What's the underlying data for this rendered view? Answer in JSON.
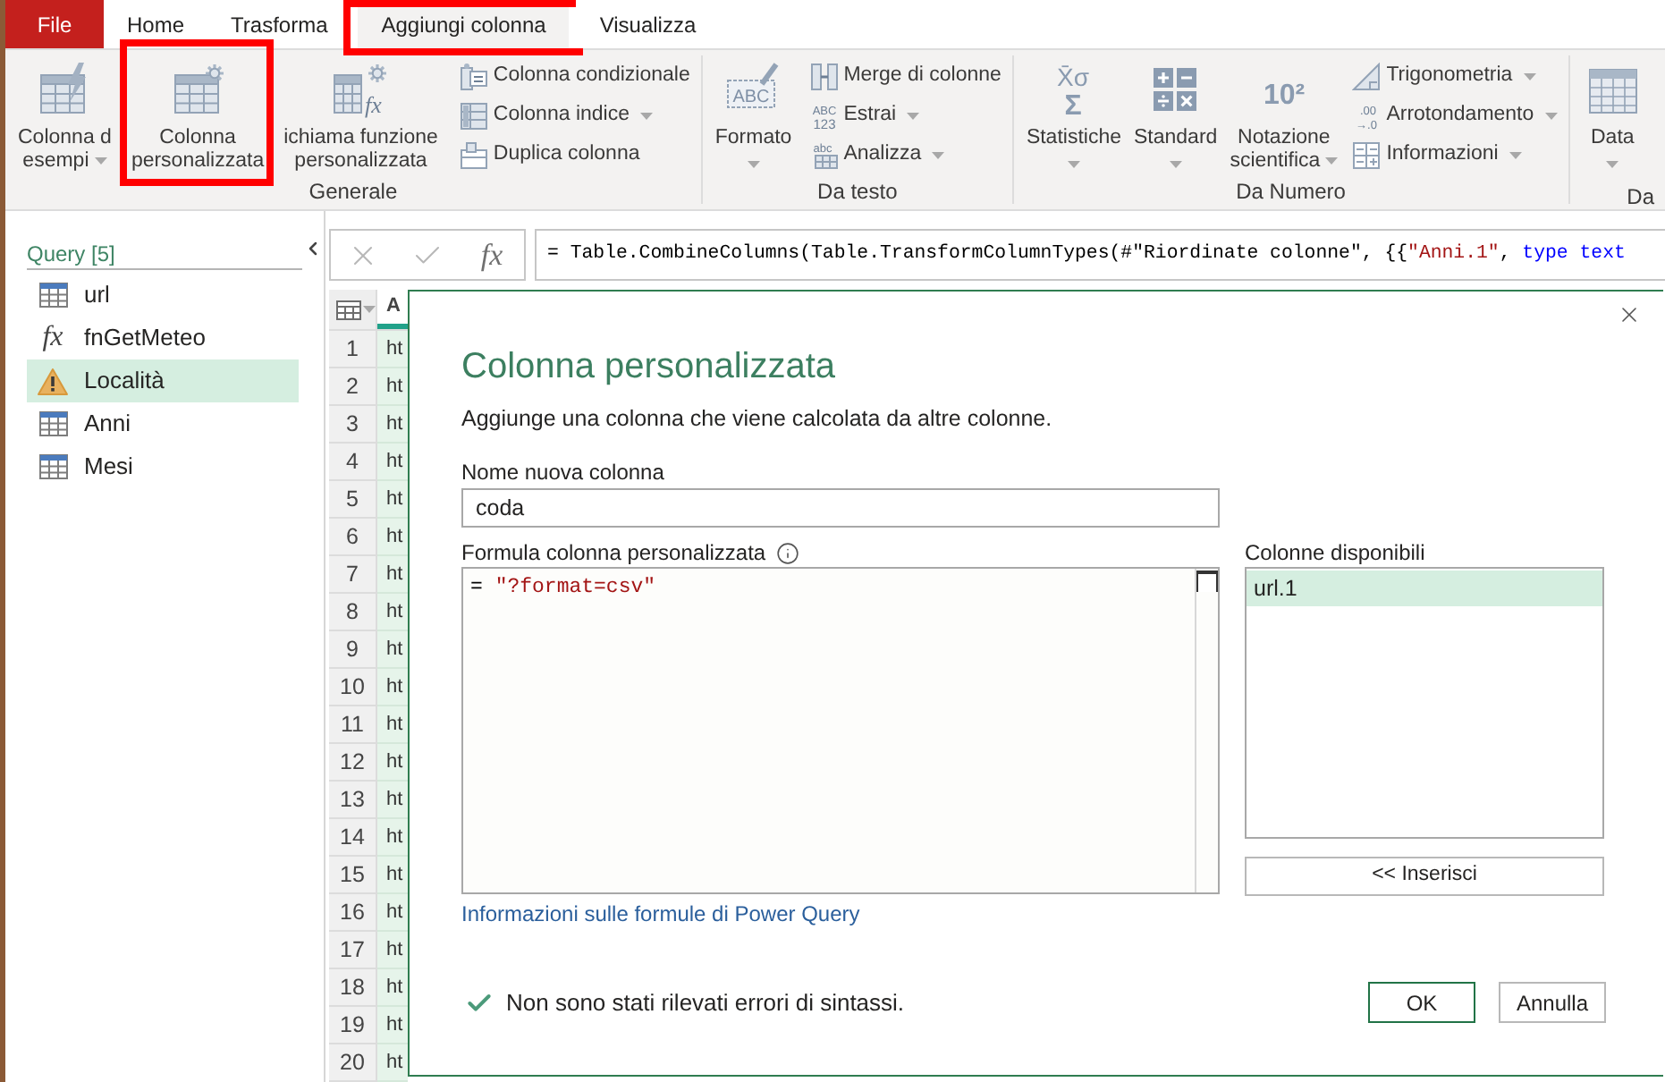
{
  "ribbon": {
    "tabs": [
      {
        "label": "File",
        "kind": "file",
        "selected": false,
        "highlighted": false
      },
      {
        "label": "Home",
        "kind": "tab",
        "selected": false,
        "highlighted": false
      },
      {
        "label": "Trasforma",
        "kind": "tab",
        "selected": false,
        "highlighted": false
      },
      {
        "label": "Aggiungi colonna",
        "kind": "tab",
        "selected": true,
        "highlighted": true
      },
      {
        "label": "Visualizza",
        "kind": "tab",
        "selected": false,
        "highlighted": false
      }
    ],
    "groups": [
      {
        "label": "Generale",
        "items": [
          {
            "kind": "large",
            "lines": [
              "Colonna d",
              "esempi"
            ],
            "dropdown": true,
            "highlighted": false
          },
          {
            "kind": "large",
            "lines": [
              "Colonna",
              "personalizzata"
            ],
            "dropdown": false,
            "highlighted": true
          },
          {
            "kind": "large",
            "lines": [
              "ichiama funzione",
              "personalizzata"
            ],
            "icon_text": "fx",
            "dropdown": false,
            "highlighted": false
          },
          {
            "kind": "small",
            "label": "Colonna condizionale",
            "dropdown": false,
            "highlighted": false
          },
          {
            "kind": "small",
            "label": "Colonna indice",
            "dropdown": true,
            "highlighted": false
          },
          {
            "kind": "small",
            "label": "Duplica colonna",
            "dropdown": false,
            "highlighted": false
          }
        ]
      },
      {
        "label": "Da testo",
        "items": [
          {
            "kind": "large",
            "lines": [
              "Formato"
            ],
            "icon_text": "ABC",
            "dropdown": true,
            "highlighted": false
          },
          {
            "kind": "small",
            "label": "Merge di colonne",
            "dropdown": false,
            "highlighted": false
          },
          {
            "kind": "small",
            "label": "Estrai",
            "icon_text": "ABC 123",
            "dropdown": true,
            "highlighted": false
          },
          {
            "kind": "small",
            "label": "Analizza",
            "icon_text": "abc",
            "dropdown": true,
            "highlighted": false
          }
        ]
      },
      {
        "label": "Da Numero",
        "items": [
          {
            "kind": "large",
            "lines": [
              "Statistiche"
            ],
            "icon_text": "X̄σ Σ",
            "dropdown": true,
            "highlighted": false
          },
          {
            "kind": "large",
            "lines": [
              "Standard"
            ],
            "dropdown": true,
            "highlighted": false
          },
          {
            "kind": "large",
            "lines": [
              "Notazione",
              "scientifica"
            ],
            "icon_text": "10²",
            "dropdown": true,
            "highlighted": false
          },
          {
            "kind": "small",
            "label": "Trigonometria",
            "dropdown": true,
            "highlighted": false
          },
          {
            "kind": "small",
            "label": "Arrotondamento",
            "icon_text": ".00 →.0",
            "dropdown": true,
            "highlighted": false
          },
          {
            "kind": "small",
            "label": "Informazioni",
            "dropdown": true,
            "highlighted": false
          }
        ]
      },
      {
        "label": "Da",
        "items": [
          {
            "kind": "large",
            "lines": [
              "Data"
            ],
            "dropdown": true,
            "highlighted": false
          }
        ]
      }
    ]
  },
  "sidebar": {
    "title": "Query [5]",
    "items": [
      {
        "label": "url",
        "kind": "table",
        "selected": false
      },
      {
        "label": "fnGetMeteo",
        "kind": "function",
        "icon_text": "fx",
        "selected": false
      },
      {
        "label": "Località",
        "kind": "warning",
        "selected": true
      },
      {
        "label": "Anni",
        "kind": "table",
        "selected": false
      },
      {
        "label": "Mesi",
        "kind": "table",
        "selected": false
      }
    ]
  },
  "formula_bar": {
    "fx_label": "fx",
    "tokens": [
      {
        "kind": "plain",
        "text": "= Table.CombineColumns(Table.TransformColumnTypes(#\"Riordinate colonne\", {{"
      },
      {
        "kind": "string",
        "text": "\"Anni.1\""
      },
      {
        "kind": "plain",
        "text": ", "
      },
      {
        "kind": "keyword",
        "text": "type text"
      }
    ]
  },
  "grid": {
    "header": "A",
    "rows": [
      {
        "number": "1",
        "value": "ht"
      },
      {
        "number": "2",
        "value": "ht"
      },
      {
        "number": "3",
        "value": "ht"
      },
      {
        "number": "4",
        "value": "ht"
      },
      {
        "number": "5",
        "value": "ht"
      },
      {
        "number": "6",
        "value": "ht"
      },
      {
        "number": "7",
        "value": "ht"
      },
      {
        "number": "8",
        "value": "ht"
      },
      {
        "number": "9",
        "value": "ht"
      },
      {
        "number": "10",
        "value": "ht"
      },
      {
        "number": "11",
        "value": "ht"
      },
      {
        "number": "12",
        "value": "ht"
      },
      {
        "number": "13",
        "value": "ht"
      },
      {
        "number": "14",
        "value": "ht"
      },
      {
        "number": "15",
        "value": "ht"
      },
      {
        "number": "16",
        "value": "ht"
      },
      {
        "number": "17",
        "value": "ht"
      },
      {
        "number": "18",
        "value": "ht"
      },
      {
        "number": "19",
        "value": "ht"
      },
      {
        "number": "20",
        "value": "ht"
      }
    ]
  },
  "dialog": {
    "title": "Colonna personalizzata",
    "subtitle": "Aggiunge una colonna che viene calcolata da altre colonne.",
    "name_label": "Nome nuova colonna",
    "name_value": "coda",
    "formula_label": "Formula colonna personalizzata",
    "formula_tokens": [
      {
        "kind": "plain",
        "text": "= "
      },
      {
        "kind": "string",
        "text": "\"?format=csv\""
      }
    ],
    "columns_label": "Colonne disponibili",
    "columns": [
      {
        "label": "url.1",
        "selected": true
      }
    ],
    "insert_button": "<< Inserisci",
    "help_link": "Informazioni sulle formule di Power Query",
    "status": {
      "kind": "ok",
      "text": "Non sono stati rilevati errori di sintassi."
    },
    "buttons": [
      {
        "label": "OK",
        "kind": "primary"
      },
      {
        "label": "Annulla",
        "kind": "secondary"
      }
    ]
  }
}
